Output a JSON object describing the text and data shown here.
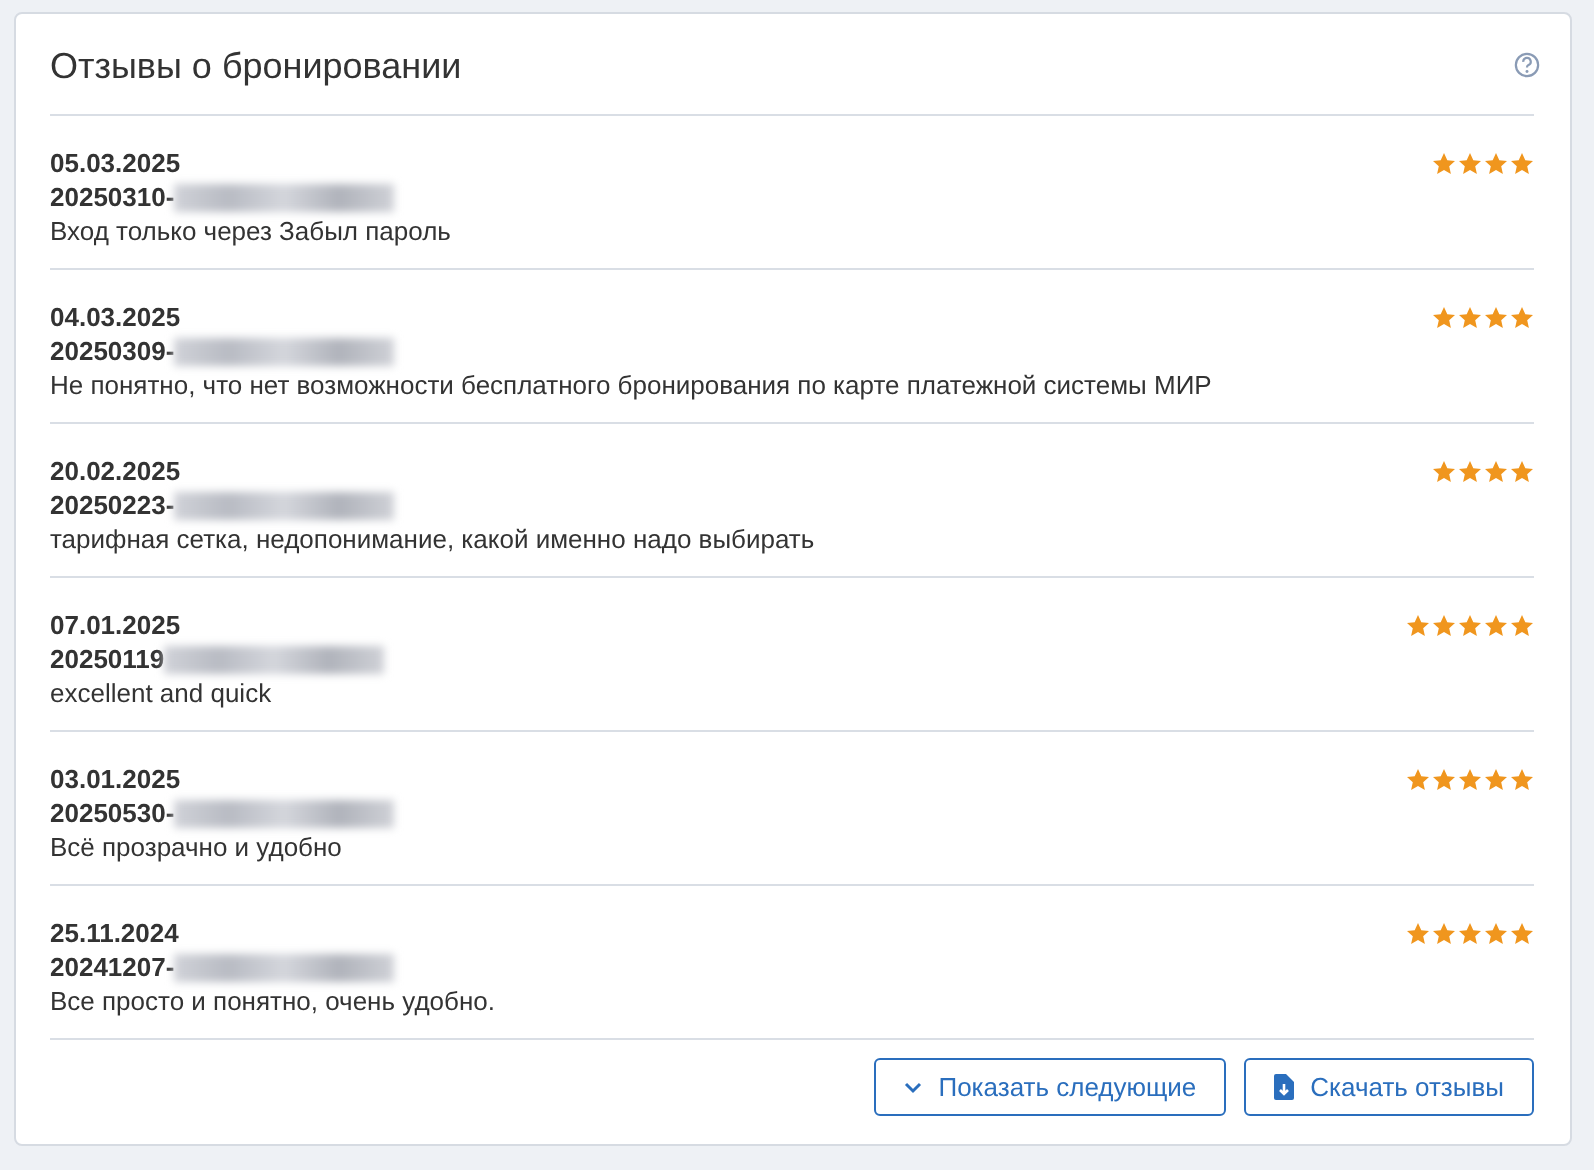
{
  "panel": {
    "title": "Отзывы о бронировании"
  },
  "reviews": [
    {
      "date": "05.03.2025",
      "booking": "20250310-",
      "text": "Вход только через Забыл пароль",
      "stars": 4
    },
    {
      "date": "04.03.2025",
      "booking": "20250309-",
      "text": "Не понятно, что нет возможности бесплатного бронирования по карте платежной системы МИР",
      "stars": 4
    },
    {
      "date": "20.02.2025",
      "booking": "20250223-",
      "text": "тарифная сетка, недопонимание, какой именно надо выбирать",
      "stars": 4
    },
    {
      "date": "07.01.2025",
      "booking": "20250119",
      "text": "excellent and quick",
      "stars": 5
    },
    {
      "date": "03.01.2025",
      "booking": "20250530-",
      "text": "Всё прозрачно и удобно",
      "stars": 5
    },
    {
      "date": "25.11.2024",
      "booking": "20241207-",
      "text": "Все просто и понятно, очень удобно.",
      "stars": 5
    }
  ],
  "buttons": [
    {
      "kind": "more",
      "label": "Показать следующие"
    },
    {
      "kind": "download",
      "label": "Скачать отзывы"
    }
  ]
}
